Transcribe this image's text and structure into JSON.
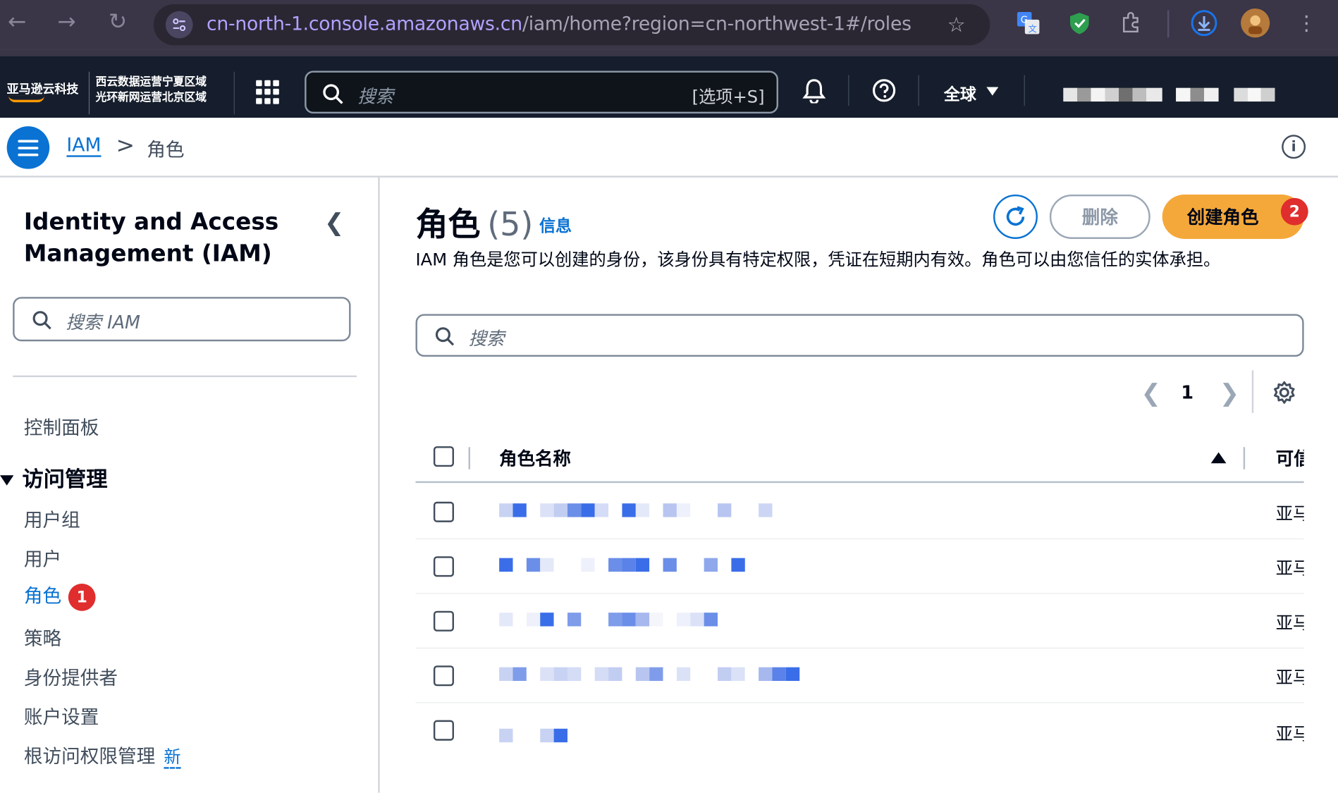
{
  "browser": {
    "url_host": "cn-north-1.console.amazonaws.cn",
    "url_path": "/iam/home?region=cn-northwest-1#/roles"
  },
  "header": {
    "logo": "亚马逊云科技",
    "region_line1": "西云数据运营宁夏区域",
    "region_line2": "光环新网运营北京区域",
    "search_placeholder": "搜索",
    "search_shortcut": "[选项+S]",
    "global_label": "全球"
  },
  "breadcrumb": {
    "root": "IAM",
    "separator": ">",
    "current": "角色"
  },
  "sidebar": {
    "title": "Identity and Access Management (IAM)",
    "search_placeholder": "搜索 IAM",
    "dashboard": "控制面板",
    "group_label": "访问管理",
    "items": [
      {
        "label": "用户组"
      },
      {
        "label": "用户"
      },
      {
        "label": "角色",
        "badge": "1"
      },
      {
        "label": "策略"
      },
      {
        "label": "身份提供者"
      },
      {
        "label": "账户设置"
      },
      {
        "label": "根访问权限管理",
        "tag": "新"
      }
    ]
  },
  "main": {
    "title": "角色",
    "count": "(5)",
    "info_link": "信息",
    "delete_label": "删除",
    "create_label": "创建角色",
    "create_badge": "2",
    "description": "IAM 角色是您可以创建的身份，该身份具有特定权限，凭证在短期内有效。角色可以由您信任的实体承担。",
    "search_placeholder": "搜索",
    "page_number": "1",
    "columns": {
      "name": "角色名称",
      "trusted": "可信"
    },
    "rows": [
      {
        "trusted": "亚马"
      },
      {
        "trusted": "亚马"
      },
      {
        "trusted": "亚马"
      },
      {
        "trusted": "亚马"
      },
      {
        "trusted": "亚马"
      }
    ]
  },
  "colors": {
    "accent_blue": "#0972d3",
    "create_orange": "#f5a83a",
    "badge_red": "#e02d2d",
    "header_dark": "#161e2d"
  }
}
